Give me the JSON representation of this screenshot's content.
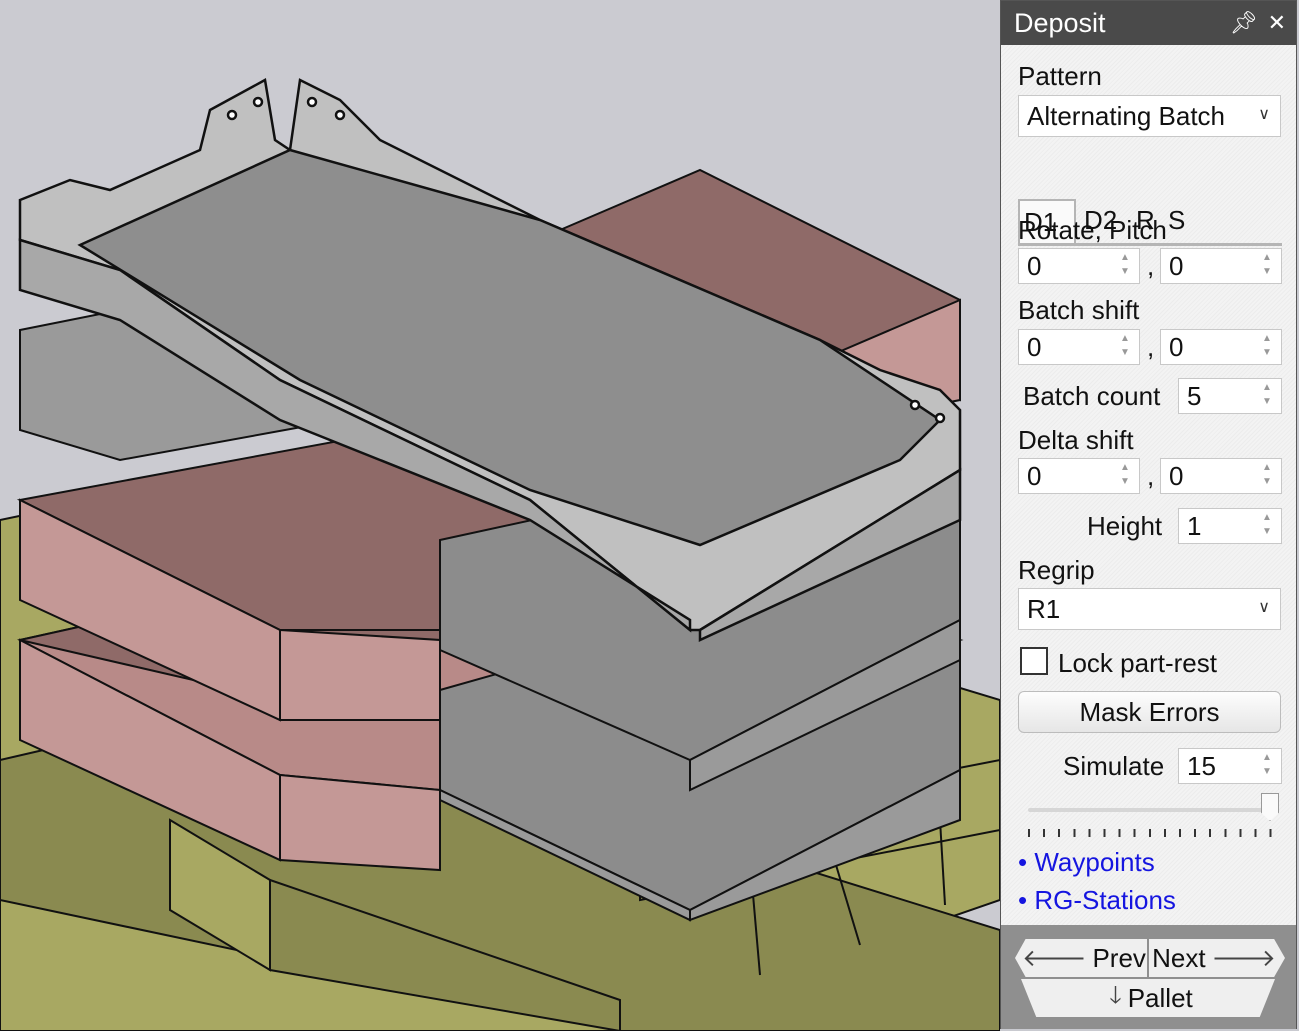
{
  "panel": {
    "title": "Deposit",
    "pin_icon": "pin-icon",
    "close_icon": "close-icon",
    "pattern_label": "Pattern",
    "pattern_value": "Alternating Batch",
    "tabs": [
      "D1",
      "D2",
      "R",
      "S"
    ],
    "active_tab": "D1",
    "rotate_pitch_label": "Rotate, Pitch",
    "rotate_value": "0",
    "pitch_value": "0",
    "batch_shift_label": "Batch shift",
    "batch_shift_x": "0",
    "batch_shift_y": "0",
    "batch_count_label": "Batch count",
    "batch_count_value": "5",
    "delta_shift_label": "Delta shift",
    "delta_shift_x": "0",
    "delta_shift_y": "0",
    "height_label": "Height",
    "height_value": "1",
    "regrip_label": "Regrip",
    "regrip_value": "R1",
    "lock_label": "Lock part-rest",
    "lock_checked": false,
    "mask_errors_label": "Mask Errors",
    "simulate_label": "Simulate",
    "simulate_value": "15",
    "simulate_slider_level": 1.0,
    "links": [
      "Waypoints",
      "RG-Stations"
    ],
    "prev_label": "Prev",
    "next_label": "Next",
    "pallet_label": "Pallet",
    "comma": ","
  },
  "colors": {
    "title_bar": "#4a4a4a",
    "link": "#1515e0",
    "pallet": "#a8a862",
    "part_gray": "#8c8c8c",
    "part_pink": "#b88a88"
  }
}
